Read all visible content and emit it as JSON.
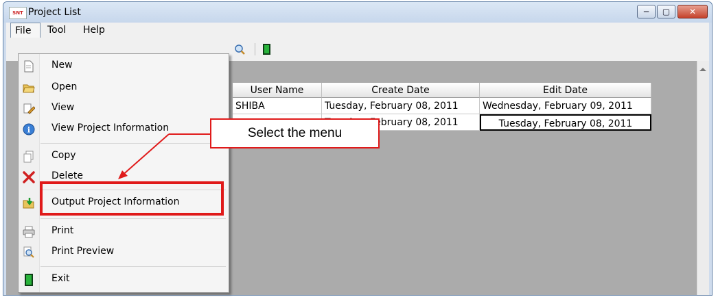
{
  "window": {
    "title": "Project List",
    "logo_text": "SNT"
  },
  "window_controls": {
    "minimize": "─",
    "maximize": "▢",
    "close": "✕"
  },
  "menubar": {
    "file": "File",
    "tool": "Tool",
    "help": "Help"
  },
  "table": {
    "headers": [
      "User Name",
      "Create Date",
      "Edit Date"
    ],
    "rows": [
      [
        "SHIBA",
        "Tuesday, February 08, 2011",
        "Wednesday, February 09, 2011"
      ],
      [
        "",
        "Tuesday, February 08, 2011",
        "Tuesday, February 08, 2011"
      ]
    ]
  },
  "file_menu": {
    "items": [
      {
        "label": "New",
        "icon": "new-document-icon"
      },
      {
        "label": "Open",
        "icon": "open-folder-icon"
      },
      {
        "label": "View",
        "icon": "view-pencil-icon"
      },
      {
        "label": "View Project Information",
        "icon": "info-icon"
      },
      {
        "label": "Copy",
        "icon": "copy-icon"
      },
      {
        "label": "Delete",
        "icon": "delete-x-icon"
      },
      {
        "label": "Output Project Information",
        "icon": "output-folder-icon"
      },
      {
        "label": "Print",
        "icon": "printer-icon"
      },
      {
        "label": "Print Preview",
        "icon": "print-preview-icon"
      },
      {
        "label": "Exit",
        "icon": "exit-door-icon"
      }
    ]
  },
  "annotation": {
    "callout_text": "Select the menu",
    "color": "#e01a1a"
  }
}
